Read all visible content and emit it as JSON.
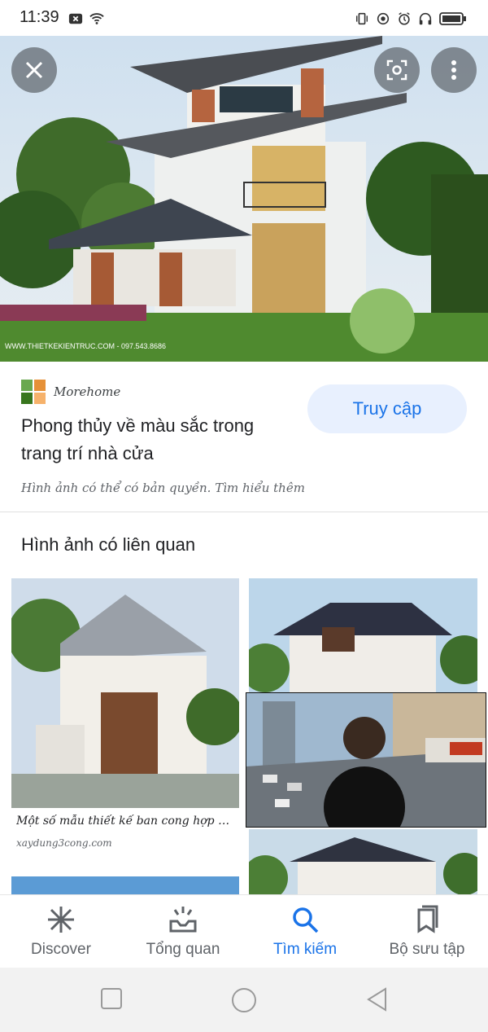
{
  "status_bar": {
    "time": "11:39",
    "left_icons": [
      "close-box-icon",
      "wifi-icon"
    ],
    "right_icons": [
      "vibrate-icon",
      "sync-icon",
      "alarm-icon",
      "headset-icon",
      "battery-icon"
    ]
  },
  "hero": {
    "watermark": "WWW.THIETKEKIENTRUC.COM - 097.543.8686",
    "buttons": [
      "close-icon",
      "lens-icon",
      "more-vert-icon"
    ]
  },
  "result": {
    "source_name": "Morehome",
    "title": "Phong thủy về màu sắc trong trang trí nhà cửa",
    "visit_label": "Truy cập",
    "copyright_note": "Hình ảnh có thể có bản quyền. Tìm hiểu thêm"
  },
  "related": {
    "heading": "Hình ảnh có liên quan",
    "items": [
      {
        "caption": "Một số mẫu thiết kế ban cong hợp phon...",
        "source": "xaydung3cong.com"
      }
    ]
  },
  "bottom_nav": {
    "items": [
      {
        "label": "Discover",
        "icon": "asterisk-icon",
        "active": false
      },
      {
        "label": "Tổng quan",
        "icon": "updates-icon",
        "active": false
      },
      {
        "label": "Tìm kiếm",
        "icon": "search-icon",
        "active": true
      },
      {
        "label": "Bộ sưu tập",
        "icon": "collections-icon",
        "active": false
      }
    ]
  },
  "colors": {
    "accent": "#1a73e8",
    "accent_bg": "#e8f0fe",
    "text": "#202124",
    "muted": "#5f6368"
  }
}
